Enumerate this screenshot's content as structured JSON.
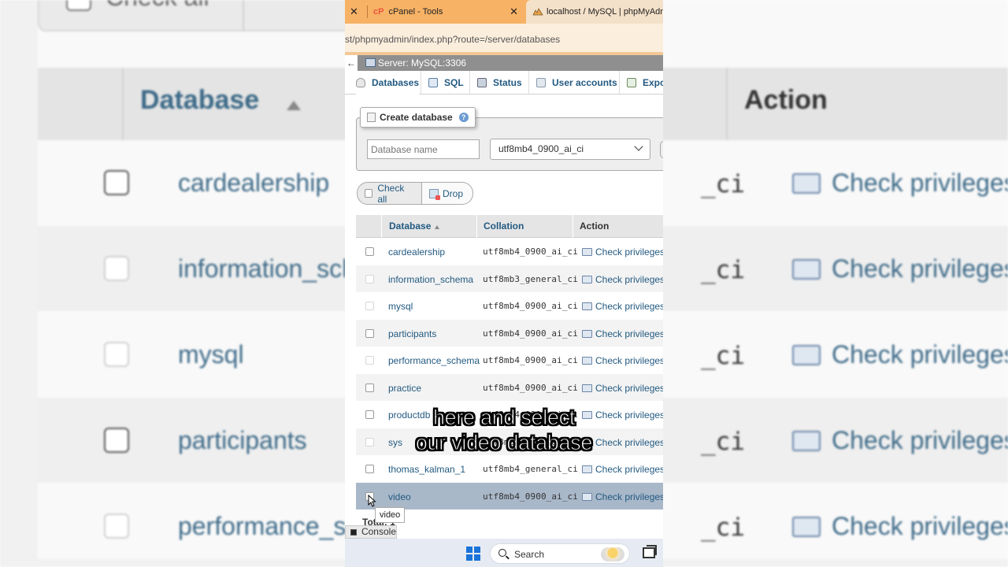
{
  "browser": {
    "tabs": [
      {
        "label": "cPanel - Tools"
      },
      {
        "label": "localhost / MySQL | phpMyAdmin"
      }
    ],
    "url": "st/phpmyadmin/index.php?route=/server/databases"
  },
  "server_bar": {
    "label": "Server: MySQL:3306"
  },
  "nav": {
    "tabs": [
      {
        "label": "Databases",
        "icon": "database-icon"
      },
      {
        "label": "SQL",
        "icon": "sql-icon"
      },
      {
        "label": "Status",
        "icon": "status-icon"
      },
      {
        "label": "User accounts",
        "icon": "users-icon"
      },
      {
        "label": "Expo",
        "icon": "export-icon"
      }
    ]
  },
  "create_database": {
    "legend": "Create database",
    "name_placeholder": "Database name",
    "collation_selected": "utf8mb4_0900_ai_ci"
  },
  "bulk_actions": {
    "check_all": "Check all",
    "drop": "Drop"
  },
  "table": {
    "headers": {
      "database": "Database",
      "collation": "Collation",
      "action": "Action"
    },
    "rows": [
      {
        "name": "cardealership",
        "collation": "utf8mb4_0900_ai_ci",
        "action": "Check privileges",
        "disabled": false
      },
      {
        "name": "information_schema",
        "collation": "utf8mb3_general_ci",
        "action": "Check privileges",
        "disabled": true
      },
      {
        "name": "mysql",
        "collation": "utf8mb4_0900_ai_ci",
        "action": "Check privileges",
        "disabled": true
      },
      {
        "name": "participants",
        "collation": "utf8mb4_0900_ai_ci",
        "action": "Check privileges",
        "disabled": false
      },
      {
        "name": "performance_schema",
        "collation": "utf8mb4_0900_ai_ci",
        "action": "Check privileges",
        "disabled": true
      },
      {
        "name": "practice",
        "collation": "utf8mb4_0900_ai_ci",
        "action": "Check privileges",
        "disabled": false
      },
      {
        "name": "productdb",
        "collation": "utf8mb4_0900_ai_ci",
        "action": "Check privileges",
        "disabled": false
      },
      {
        "name": "sys",
        "collation": "utf8mb4_0900_ai_ci",
        "action": "Check privileges",
        "disabled": true
      },
      {
        "name": "thomas_kalman_1",
        "collation": "utf8mb4_general_ci",
        "action": "Check privileges",
        "disabled": false
      },
      {
        "name": "video",
        "collation": "utf8mb4_0900_ai_ci",
        "action": "Check privileges",
        "disabled": false,
        "highlighted": true
      }
    ],
    "total_label": "Total: 1"
  },
  "tooltip": "video",
  "console": {
    "label": "Console"
  },
  "taskbar": {
    "search_label": "Search"
  },
  "subtitles": [
    "here and select",
    "our video database"
  ],
  "background": {
    "top_button": "Check all",
    "headers": {
      "database": "Database",
      "action": "Action"
    },
    "rows": [
      {
        "name": "cardealership",
        "collation": "_ci",
        "action": "Check privileges"
      },
      {
        "name": "information_sche",
        "collation": "_ci",
        "action": "Check privileges"
      },
      {
        "name": "mysql",
        "collation": "_ci",
        "action": "Check privileges"
      },
      {
        "name": "participants",
        "collation": "_ci",
        "action": "Check privileges"
      },
      {
        "name": "performance_sch",
        "collation": "_ci",
        "action": "Check privileges"
      }
    ]
  },
  "colors": {
    "link": "#235a81",
    "tabbar": "#f7b265",
    "highlight_row": "#a9b8c9"
  }
}
